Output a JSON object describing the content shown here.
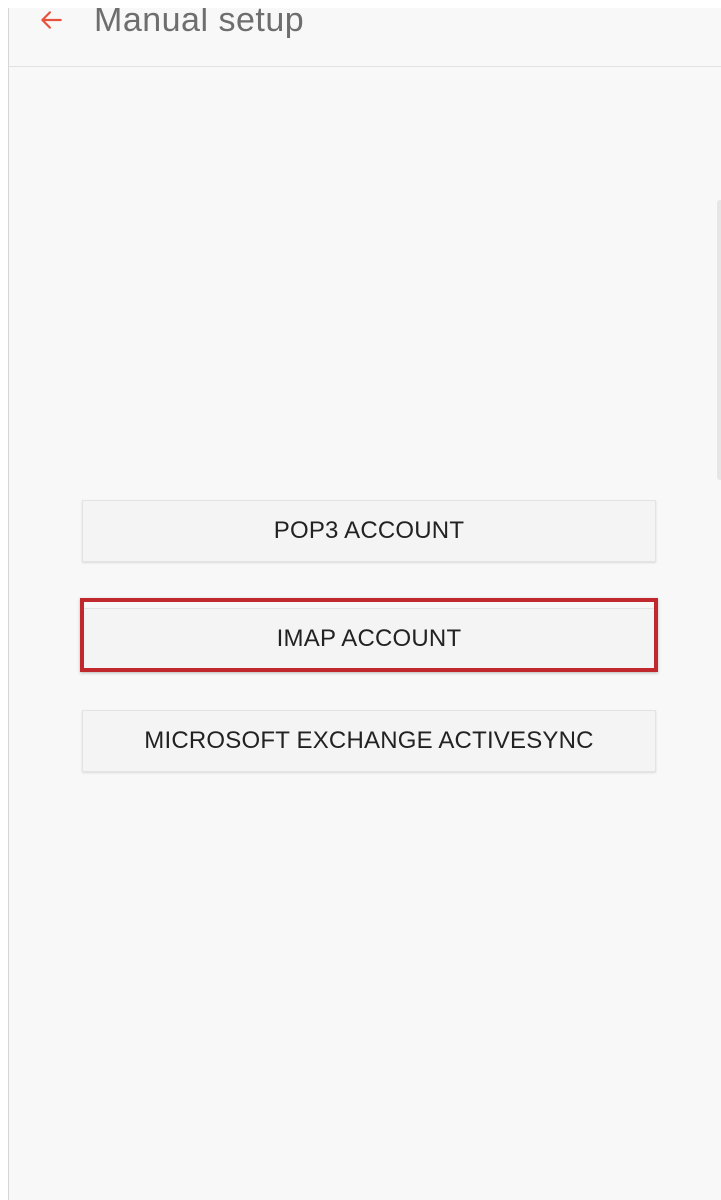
{
  "header": {
    "title": "Manual setup",
    "back_icon": "arrow-left-icon",
    "accent_color": "#e8513b"
  },
  "options": [
    {
      "label": "POP3 ACCOUNT"
    },
    {
      "label": "IMAP ACCOUNT",
      "highlighted": true
    },
    {
      "label": "MICROSOFT EXCHANGE ACTIVESYNC"
    }
  ],
  "highlight_color": "#c0282e"
}
